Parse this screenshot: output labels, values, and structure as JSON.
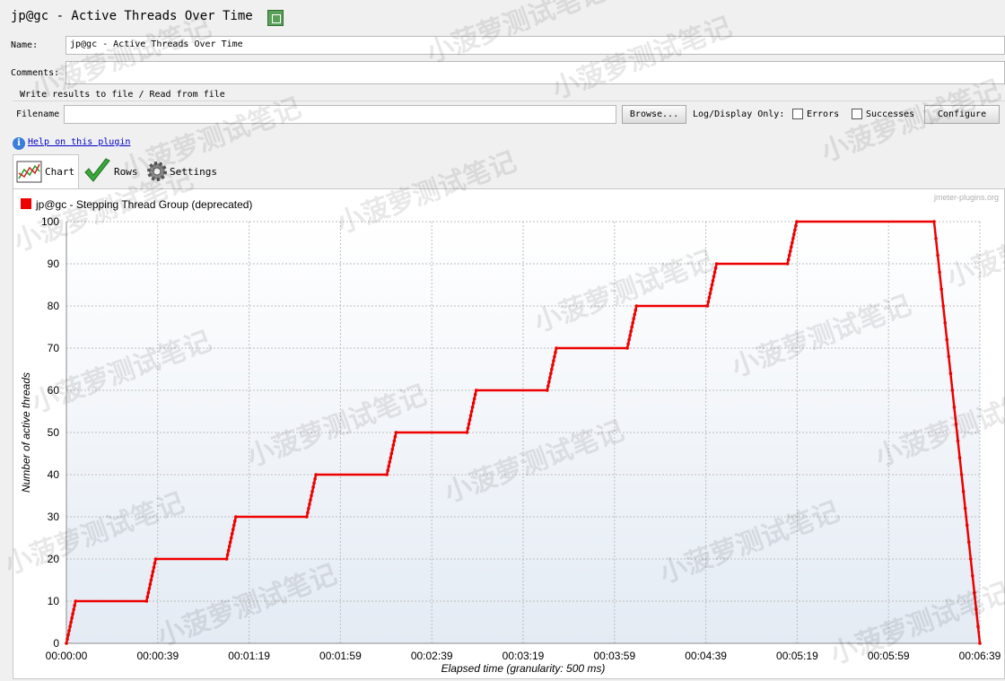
{
  "window": {
    "title": "jp@gc - Active Threads Over Time"
  },
  "form": {
    "name_label": "Name:",
    "name_value": "jp@gc - Active Threads Over Time",
    "comments_label": "Comments:",
    "comments_value": "",
    "file_group_title": "Write results to file / Read from file",
    "filename_label": "Filename",
    "filename_value": "",
    "browse_label": "Browse...",
    "log_display_label": "Log/Display Only:",
    "errors_label": "Errors",
    "errors_checked": false,
    "successes_label": "Successes",
    "successes_checked": false,
    "configure_label": "Configure"
  },
  "help": {
    "link_text": "Help on this plugin"
  },
  "tabs": [
    {
      "label": "Chart",
      "icon": "chart-icon",
      "active": true
    },
    {
      "label": "Rows",
      "icon": "checkmark-icon",
      "active": false
    },
    {
      "label": "Settings",
      "icon": "gear-icon",
      "active": false
    }
  ],
  "chart": {
    "watermark_site": "jmeter-plugins.org",
    "overlay_watermark": "小菠萝测试笔记",
    "line_color": "#ee0000"
  },
  "chart_data": {
    "type": "line",
    "legend": [
      "jp@gc - Stepping Thread Group (deprecated)"
    ],
    "xlabel": "Elapsed time (granularity: 500 ms)",
    "ylabel": "Number of active threads",
    "x_ticks": [
      "00:00:00",
      "00:00:39",
      "00:01:19",
      "00:01:59",
      "00:02:39",
      "00:03:19",
      "00:03:59",
      "00:04:39",
      "00:05:19",
      "00:05:59",
      "00:06:39"
    ],
    "y_ticks": [
      0,
      10,
      20,
      30,
      40,
      50,
      60,
      70,
      80,
      90,
      100
    ],
    "ylim": [
      0,
      100
    ],
    "xlim_seconds": [
      0,
      399
    ],
    "grid": true,
    "legend_position": "top-left",
    "series": [
      {
        "name": "jp@gc - Stepping Thread Group (deprecated)",
        "points_seconds": [
          [
            0,
            0
          ],
          [
            4,
            10
          ],
          [
            35,
            10
          ],
          [
            39,
            20
          ],
          [
            70,
            20
          ],
          [
            74,
            30
          ],
          [
            105,
            30
          ],
          [
            109,
            40
          ],
          [
            140,
            40
          ],
          [
            144,
            50
          ],
          [
            175,
            50
          ],
          [
            179,
            60
          ],
          [
            210,
            60
          ],
          [
            214,
            70
          ],
          [
            245,
            70
          ],
          [
            249,
            80
          ],
          [
            280,
            80
          ],
          [
            284,
            90
          ],
          [
            315,
            90
          ],
          [
            319,
            100
          ],
          [
            379,
            100
          ],
          [
            399,
            0
          ]
        ]
      }
    ]
  }
}
